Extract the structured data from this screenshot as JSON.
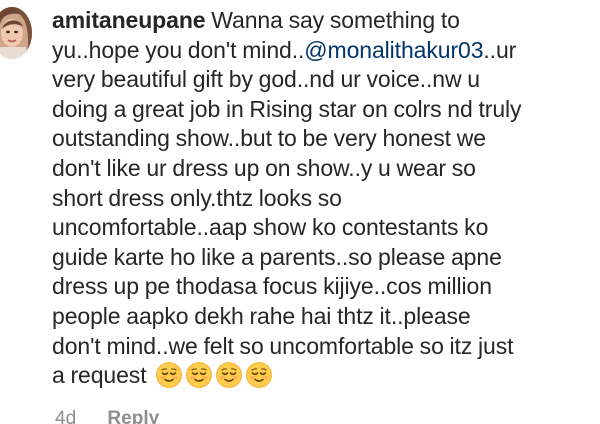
{
  "comment": {
    "avatar_icon": "profile-photo",
    "username": "amitaneupane",
    "lines": [
      {
        "pre": " Wanna say something to"
      },
      {
        "pre": "yu..hope you don't mind..",
        "mention": "@monalithakur03",
        "post": "..ur"
      },
      {
        "pre": "very beautiful gift by god..nd ur voice..nw u"
      },
      {
        "pre": "doing a great job in Rising star on colrs nd truly"
      },
      {
        "pre": "outstanding show..but to be very honest we"
      },
      {
        "pre": "don't like ur dress up on show..y u wear so"
      },
      {
        "pre": "short dress only.thtz looks so"
      },
      {
        "pre": "uncomfortable..aap show ko contestants ko"
      },
      {
        "pre": "guide karte ho like a parents..so please apne"
      },
      {
        "pre": "dress up pe thodasa focus kijiye..cos million"
      },
      {
        "pre": "people aapko dekh rahe hai thtz it..please"
      },
      {
        "pre": "don't mind..we felt so uncomfortable so itz just"
      },
      {
        "pre": "a request "
      }
    ],
    "emojis": [
      "relieved-face-emoji",
      "relieved-face-emoji",
      "relieved-face-emoji",
      "relieved-face-emoji"
    ],
    "time": "4d",
    "reply_label": "Reply",
    "colors": {
      "text": "#262626",
      "mention": "#003569",
      "meta": "#8e8e8e",
      "emoji": "#ffcc4d"
    }
  }
}
